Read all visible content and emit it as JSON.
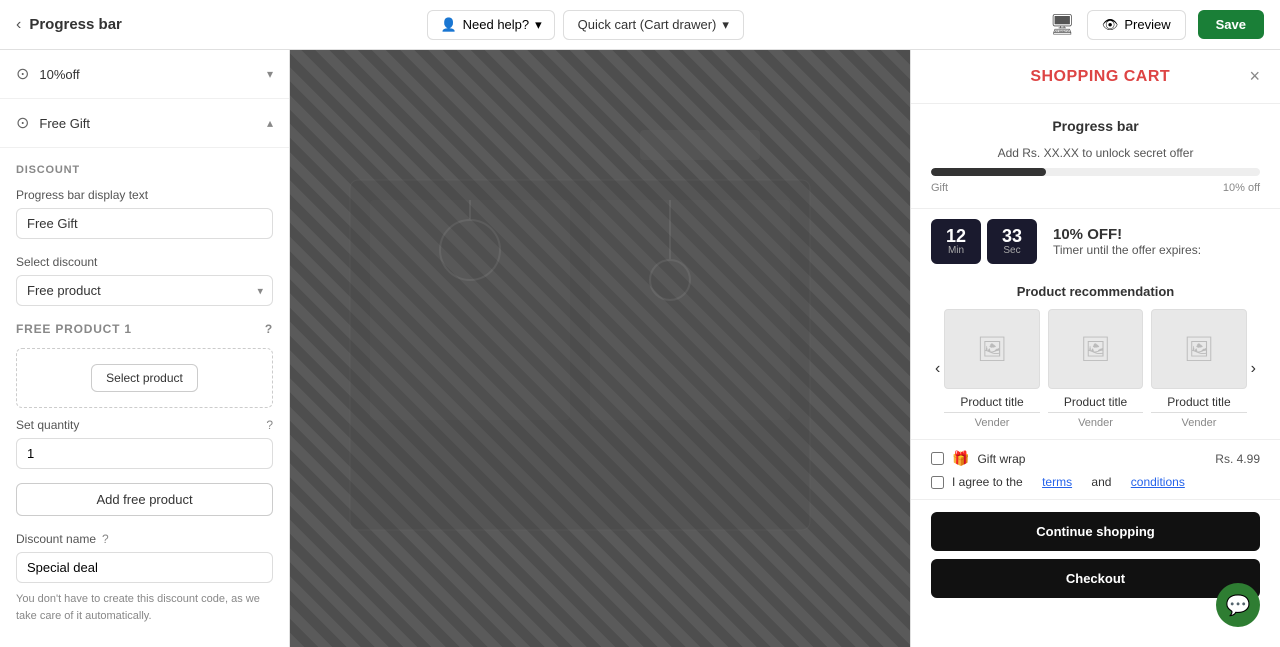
{
  "header": {
    "back_label": "‹",
    "page_title": "Progress bar",
    "help_label": "Need help?",
    "dropdown_label": "Quick cart (Cart drawer)",
    "preview_label": "Preview",
    "save_label": "Save"
  },
  "sidebar": {
    "sections": [
      {
        "icon": "⊙",
        "label": "10%off",
        "expanded": false
      },
      {
        "icon": "⊙",
        "label": "Free Gift",
        "expanded": true
      }
    ],
    "discount_group_title": "DISCOUNT",
    "progress_bar_display_label": "Progress bar display text",
    "progress_bar_display_value": "Free Gift",
    "select_discount_label": "Select discount",
    "select_discount_value": "Free product",
    "free_product_section_title": "FREE PRODUCT 1",
    "select_product_btn_label": "Select product",
    "set_quantity_label": "Set quantity",
    "set_quantity_value": "1",
    "add_free_product_btn_label": "Add free product",
    "discount_name_label": "Discount name",
    "discount_name_value": "Special deal",
    "hint_text": "You don't have to create this discount code, as we take care of it automatically."
  },
  "cart": {
    "title": "SHOPPING CART",
    "close_label": "×",
    "progress_section_title": "Progress bar",
    "progress_info_text": "Add Rs. XX.XX to unlock secret offer",
    "progress_fill_percent": 35,
    "progress_label_left": "Gift",
    "progress_label_right": "10% off",
    "product_rec_title": "Product recommendation",
    "timer_minutes": "12",
    "timer_seconds": "33",
    "timer_min_label": "Min",
    "timer_sec_label": "Sec",
    "timer_percent": "10% OFF!",
    "timer_desc": "Timer until the offer expires:",
    "products": [
      {
        "name": "Product title",
        "vendor": "Vender"
      },
      {
        "name": "Product title",
        "vendor": "Vender"
      },
      {
        "name": "Product title",
        "vendor": "Vender"
      }
    ],
    "gift_wrap_label": "Gift wrap",
    "gift_wrap_price": "Rs. 4.99",
    "terms_prefix": "I agree to the",
    "terms_link": "terms",
    "terms_and": "and",
    "conditions_link": "conditions",
    "continue_btn_label": "Continue shopping",
    "checkout_btn_label": "Checkout"
  }
}
